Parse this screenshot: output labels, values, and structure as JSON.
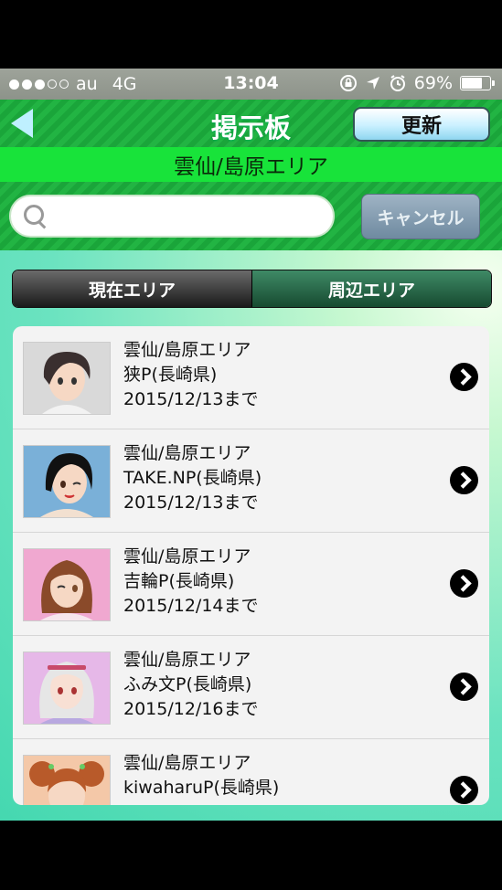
{
  "status_bar": {
    "carrier": "au",
    "network": "4G",
    "time": "13:04",
    "battery": "69%",
    "battery_level": 0.69,
    "signal_dots_filled": 3,
    "signal_dots_total": 5
  },
  "nav": {
    "title": "掲示板",
    "refresh_label": "更新"
  },
  "area_title": "雲仙/島原エリア",
  "search": {
    "value": "",
    "cancel_label": "キャンセル"
  },
  "tabs": [
    "現在エリア",
    "周辺エリア"
  ],
  "posts": [
    {
      "area": "雲仙/島原エリア",
      "name": "狭P(長崎県)",
      "date": "2015/12/13まで",
      "avatar": "dark-short-hair"
    },
    {
      "area": "雲仙/島原エリア",
      "name": "TAKE.NP(長崎県)",
      "date": "2015/12/13まで",
      "avatar": "black-long-hair"
    },
    {
      "area": "雲仙/島原エリア",
      "name": "吉輪P(長崎県)",
      "date": "2015/12/14まで",
      "avatar": "brown-hair-pink"
    },
    {
      "area": "雲仙/島原エリア",
      "name": "ふみ文P(長崎県)",
      "date": "2015/12/16まで",
      "avatar": "silver-hair"
    },
    {
      "area": "雲仙/島原エリア",
      "name": "kiwaharuP(長崎県)",
      "date": "",
      "avatar": "orange-pigtails"
    }
  ],
  "colors": {
    "nav_green": "#1aa53a",
    "area_bar": "#18e33a",
    "refresh_button": "#c9f0ff",
    "cancel_button": "#7f98ac"
  }
}
